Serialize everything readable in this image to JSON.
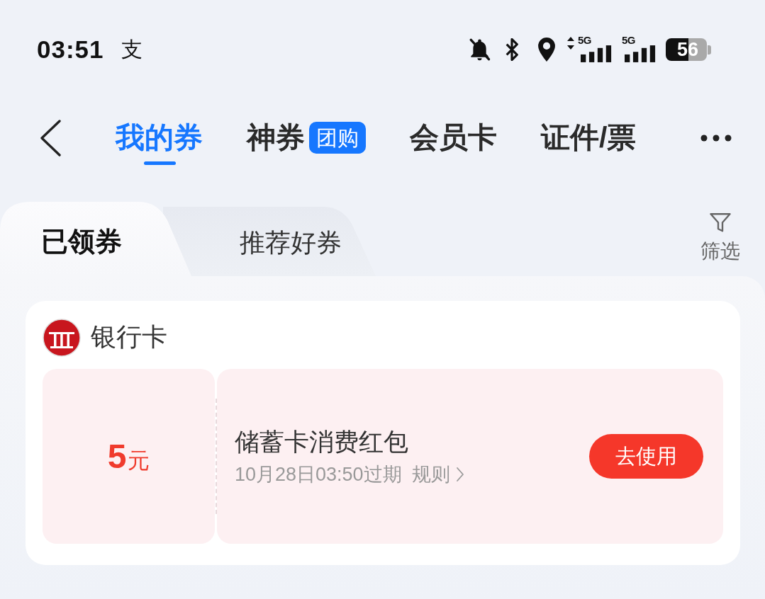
{
  "status_bar": {
    "time": "03:51",
    "notification_icon": "支",
    "signals": [
      {
        "label": "5G",
        "activity": true
      },
      {
        "label": "5G",
        "activity": false
      }
    ],
    "battery": "56"
  },
  "nav": {
    "tabs": [
      {
        "label": "我的券",
        "selected": true
      },
      {
        "label": "神券",
        "selected": false,
        "badge": "团购"
      },
      {
        "label": "会员卡",
        "selected": false
      },
      {
        "label": "证件/票",
        "selected": false
      }
    ]
  },
  "sub_tabs": [
    {
      "label": "已领券",
      "selected": true
    },
    {
      "label": "推荐好券",
      "selected": false
    }
  ],
  "filter": {
    "label": "筛选"
  },
  "group": {
    "title": "银行卡",
    "coupons": [
      {
        "amount": "5",
        "unit": "元",
        "title": "储蓄卡消费红包",
        "expiry": "10月28日03:50过期",
        "rules_link": "规则",
        "action": "去使用"
      }
    ]
  }
}
